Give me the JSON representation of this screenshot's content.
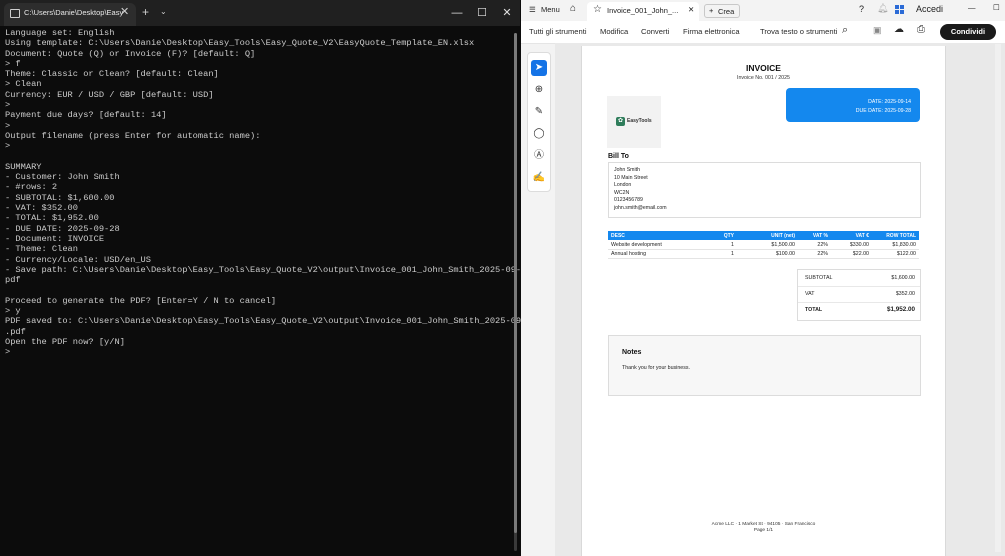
{
  "terminal": {
    "tab_title": "C:\\Users\\Danie\\Desktop\\Easy",
    "new_tab": "+",
    "dropdown": "⌄",
    "lines": [
      "Language set: English",
      "Using template: C:\\Users\\Danie\\Desktop\\Easy_Tools\\Easy_Quote_V2\\EasyQuote_Template_EN.xlsx",
      "Document: Quote (Q) or Invoice (F)? [default: Q]",
      "> f",
      "Theme: Classic or Clean? [default: Clean]",
      "> Clean",
      "Currency: EUR / USD / GBP [default: USD]",
      ">",
      "Payment due days? [default: 14]",
      ">",
      "Output filename (press Enter for automatic name):",
      ">",
      "",
      "SUMMARY",
      "- Customer: John Smith",
      "- #rows: 2",
      "- SUBTOTAL: $1,600.00",
      "- VAT: $352.00",
      "- TOTAL: $1,952.00",
      "- DUE DATE: 2025-09-28",
      "- Document: INVOICE",
      "- Theme: Clean",
      "- Currency/Locale: USD/en_US",
      "- Save path: C:\\Users\\Danie\\Desktop\\Easy_Tools\\Easy_Quote_V2\\output\\Invoice_001_John_Smith_2025-09-14.",
      "pdf",
      "",
      "Proceed to generate the PDF? [Enter=Y / N to cancel]",
      "> y",
      "PDF saved to: C:\\Users\\Danie\\Desktop\\Easy_Tools\\Easy_Quote_V2\\output\\Invoice_001_John_Smith_2025-09-14",
      ".pdf",
      "Open the PDF now? [y/N]",
      ">"
    ]
  },
  "acrobat": {
    "menu": "Menu",
    "tab_title": "Invoice_001_John_...",
    "create": "Crea",
    "sign_in": "Accedi",
    "share": "Condividi",
    "tools": [
      "Tutti gli strumenti",
      "Modifica",
      "Converti",
      "Firma elettronica"
    ],
    "search_tools": "Trova testo o strumenti"
  },
  "invoice": {
    "title": "INVOICE",
    "number": "Invoice No. 001 / 2025",
    "logo_text": "EasyTools",
    "date": "DATE: 2025-09-14",
    "due_date": "DUE DATE: 2025-09-28",
    "bill_to_label": "Bill To",
    "bill_to": [
      "John Smith",
      "10 Main Street",
      "London",
      "WC2N",
      "0123456789",
      "john.smith@email.com"
    ],
    "columns": [
      "DESC",
      "QTY",
      "UNIT (net)",
      "VAT %",
      "VAT €",
      "ROW TOTAL"
    ],
    "items": [
      [
        "Website development",
        "1",
        "$1,500.00",
        "22%",
        "$330.00",
        "$1,830.00"
      ],
      [
        "Annual hosting",
        "1",
        "$100.00",
        "22%",
        "$22.00",
        "$122.00"
      ]
    ],
    "totals": [
      {
        "label": "SUBTOTAL",
        "value": "$1,600.00"
      },
      {
        "label": "VAT",
        "value": "$352.00"
      },
      {
        "label": "TOTAL",
        "value": "$1,952.00"
      }
    ],
    "notes_title": "Notes",
    "notes_text": "Thank you for your business.",
    "footer_line1": "Acme LLC · 1 Market St · 94105 · San Francisco",
    "footer_line2": "Page 1/1"
  },
  "colors": {
    "accent": "#1488ee",
    "terminal_bg": "#0c0c0c",
    "logo_green": "#2f7d5b"
  }
}
